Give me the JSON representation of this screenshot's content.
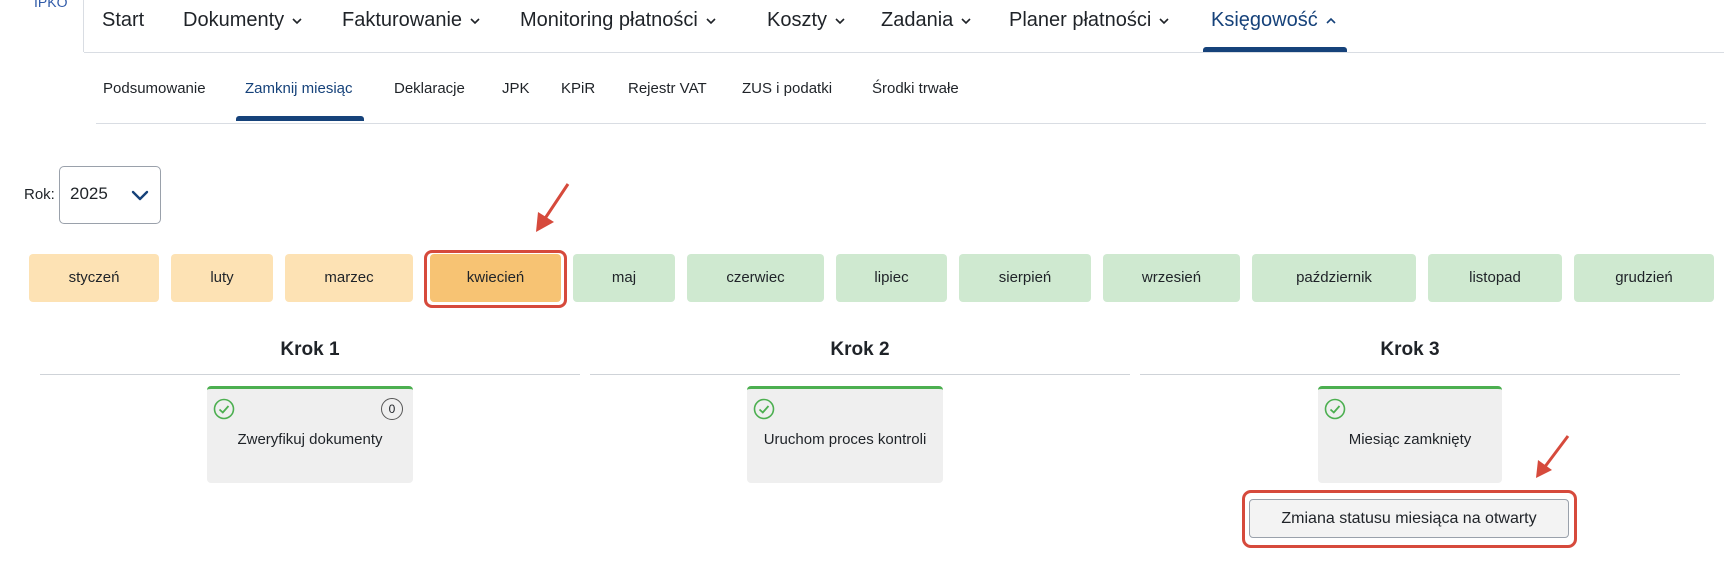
{
  "brand": {
    "text": "IPKO"
  },
  "topnav": {
    "items": [
      {
        "label": "Start",
        "dropdown": false
      },
      {
        "label": "Dokumenty",
        "dropdown": true
      },
      {
        "label": "Fakturowanie",
        "dropdown": true
      },
      {
        "label": "Monitoring płatności",
        "dropdown": true
      },
      {
        "label": "Koszty",
        "dropdown": true
      },
      {
        "label": "Zadania",
        "dropdown": true
      },
      {
        "label": "Planer płatności",
        "dropdown": true
      },
      {
        "label": "Księgowość",
        "dropdown": true,
        "active": true,
        "expanded": true
      }
    ]
  },
  "subnav": {
    "items": [
      {
        "label": "Podsumowanie"
      },
      {
        "label": "Zamknij miesiąc",
        "active": true
      },
      {
        "label": "Deklaracje"
      },
      {
        "label": "JPK"
      },
      {
        "label": "KPiR"
      },
      {
        "label": "Rejestr VAT"
      },
      {
        "label": "ZUS i podatki"
      },
      {
        "label": "Środki trwałe"
      }
    ]
  },
  "year": {
    "label": "Rok:",
    "value": "2025"
  },
  "months": [
    {
      "label": "styczeń",
      "status": "closed"
    },
    {
      "label": "luty",
      "status": "closed"
    },
    {
      "label": "marzec",
      "status": "closed"
    },
    {
      "label": "kwiecień",
      "status": "selected"
    },
    {
      "label": "maj",
      "status": "open"
    },
    {
      "label": "czerwiec",
      "status": "open"
    },
    {
      "label": "lipiec",
      "status": "open"
    },
    {
      "label": "sierpień",
      "status": "open"
    },
    {
      "label": "wrzesień",
      "status": "open"
    },
    {
      "label": "październik",
      "status": "open"
    },
    {
      "label": "listopad",
      "status": "open"
    },
    {
      "label": "grudzień",
      "status": "open"
    }
  ],
  "steps": [
    {
      "title": "Krok 1",
      "card_label": "Zweryfikuj dokumenty",
      "badge": "0",
      "done": true
    },
    {
      "title": "Krok 2",
      "card_label": "Uruchom proces kontroli",
      "done": true
    },
    {
      "title": "Krok 3",
      "card_label": "Miesiąc zamknięty",
      "done": true
    }
  ],
  "reopen_button": {
    "label": "Zmiana statusu miesiąca na otwarty"
  },
  "colors": {
    "accent": "#16427a",
    "month_closed": "#fde2b4",
    "month_selected": "#f7c373",
    "month_open": "#cfe9d0",
    "step_done": "#4caf50",
    "highlight": "#d64a3c"
  }
}
